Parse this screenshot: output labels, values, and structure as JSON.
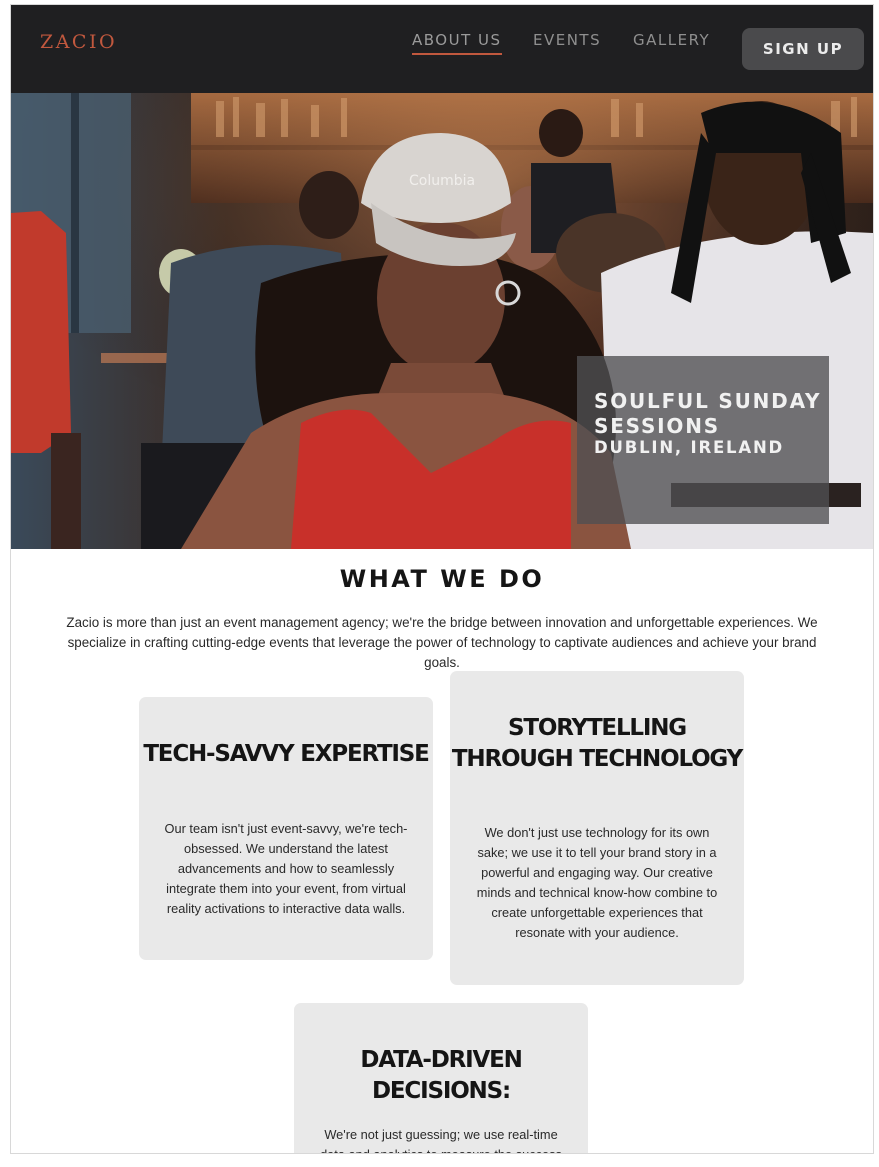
{
  "header": {
    "logo": "ZACIO",
    "nav": [
      {
        "label": "ABOUT US",
        "active": true
      },
      {
        "label": "EVENTS",
        "active": false
      },
      {
        "label": "GALLERY",
        "active": false
      }
    ],
    "signup_label": "SIGN UP"
  },
  "hero": {
    "title": "SOULFUL SUNDAY SESSIONS",
    "location": "DUBLIN, IRELAND",
    "cap_text": "Columbia"
  },
  "what_we_do": {
    "title": "WHAT WE DO",
    "intro": "Zacio is more than just an event management agency; we're the bridge between innovation and unforgettable experiences. We specialize in crafting cutting-edge events that leverage the power of technology to captivate audiences and achieve your brand goals.",
    "cards": [
      {
        "title": "TECH-SAVVY EXPERTISE",
        "body": "Our team isn't just event-savvy, we're tech-obsessed. We understand the latest advancements and how to seamlessly integrate them into your event, from virtual reality activations to interactive data walls."
      },
      {
        "title": "STORYTELLING THROUGH TECHNOLOGY",
        "body": "We don't just use technology for its own sake; we use it to tell your brand story in a powerful and engaging way. Our creative minds and technical know-how combine to create unforgettable experiences that resonate with your audience."
      },
      {
        "title": "DATA-DRIVEN DECISIONS:",
        "body": "We're not just guessing; we use real-time data and analytics to measure the success of your"
      }
    ]
  },
  "colors": {
    "header_bg": "#1f1f21",
    "accent": "#c1583e",
    "card_bg": "#e9e9e9"
  }
}
